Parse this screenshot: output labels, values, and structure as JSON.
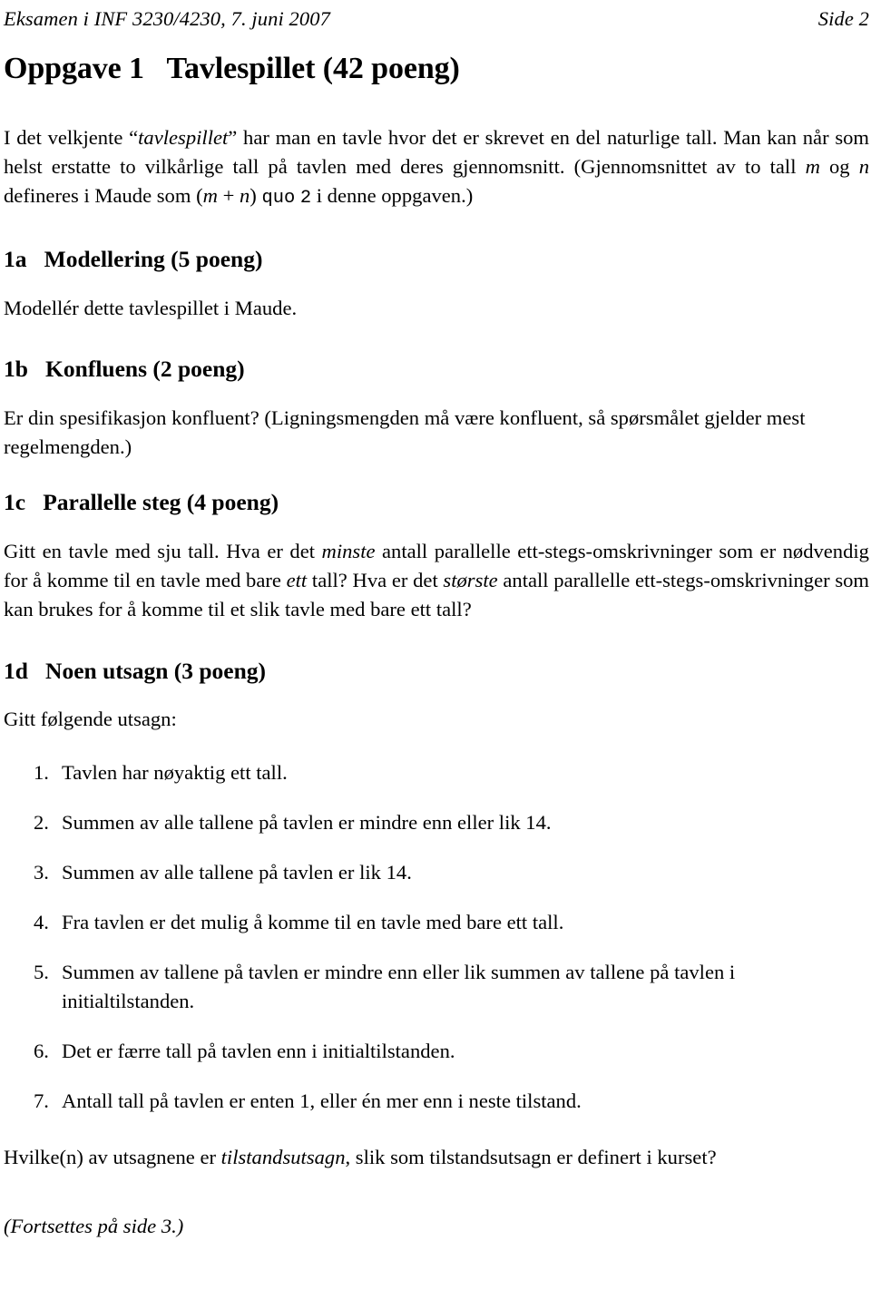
{
  "header": {
    "left": "Eksamen i INF 3230/4230, 7. juni 2007",
    "right": "Side 2"
  },
  "title": "Oppgave 1   Tavlespillet (42 poeng)",
  "intro": {
    "t1": "I det velkjente “",
    "em1": "tavlespillet",
    "t2": "” har man en tavle hvor det er skrevet en del naturlige tall. Man kan når som helst erstatte to vilkårlige tall på tavlen med deres gjennomsnitt. (Gjennomsnittet av to tall ",
    "var_m": "m",
    "t3": " og ",
    "var_n": "n",
    "t4": " defineres i Maude som (",
    "var_m2": "m",
    "t5": " + ",
    "var_n2": "n",
    "t6": ") ",
    "tt_quo": "quo",
    "t7": " ",
    "tt_two": "2",
    "t8": " i denne oppgaven.)"
  },
  "sections": [
    {
      "heading": "1a   Modellering (5 poeng)",
      "body": "Modellér dette tavlespillet i Maude."
    },
    {
      "heading": "1b   Konfluens (2 poeng)",
      "body": "Er din spesifikasjon konfluent? (Ligningsmengden må være konfluent, så spørsmålet gjelder mest regelmengden.)"
    },
    {
      "heading": "1c   Parallelle steg (4 poeng)",
      "c1": "Gitt en tavle med sju tall. Hva er det ",
      "em1": "minste",
      "c2": " antall parallelle ett-stegs-omskrivninger som er nødvendig for å komme til en tavle med bare ",
      "em2": "ett",
      "c3": " tall? Hva er det ",
      "em3": "største",
      "c4": " antall parallelle ett-stegs-omskrivninger som kan brukes for å komme til et slik tavle med bare ett tall?"
    },
    {
      "heading": "1d   Noen utsagn (3 poeng)",
      "lead": "Gitt følgende utsagn:"
    }
  ],
  "utsagn": [
    {
      "num": "1.",
      "text": "Tavlen har nøyaktig ett tall."
    },
    {
      "num": "2.",
      "text": "Summen av alle tallene på tavlen er mindre enn eller lik 14."
    },
    {
      "num": "3.",
      "text": "Summen av alle tallene på tavlen er lik 14."
    },
    {
      "num": "4.",
      "text": "Fra tavlen er det mulig å komme til en tavle med bare ett tall."
    },
    {
      "num": "5.",
      "text": "Summen av tallene på tavlen er mindre enn eller lik summen av tallene på tavlen i initialtilstanden."
    },
    {
      "num": "6.",
      "text": "Det er færre tall på tavlen enn i initialtilstanden."
    },
    {
      "num": "7.",
      "text": "Antall tall på tavlen er enten 1, eller én mer enn i neste tilstand."
    }
  ],
  "closing": {
    "q1": "Hvilke(n) av utsagnene er ",
    "em": "tilstandsutsagn",
    "q2": ", slik som tilstandsutsagn er definert i kurset?"
  },
  "footer": "(Fortsettes på side 3.)"
}
